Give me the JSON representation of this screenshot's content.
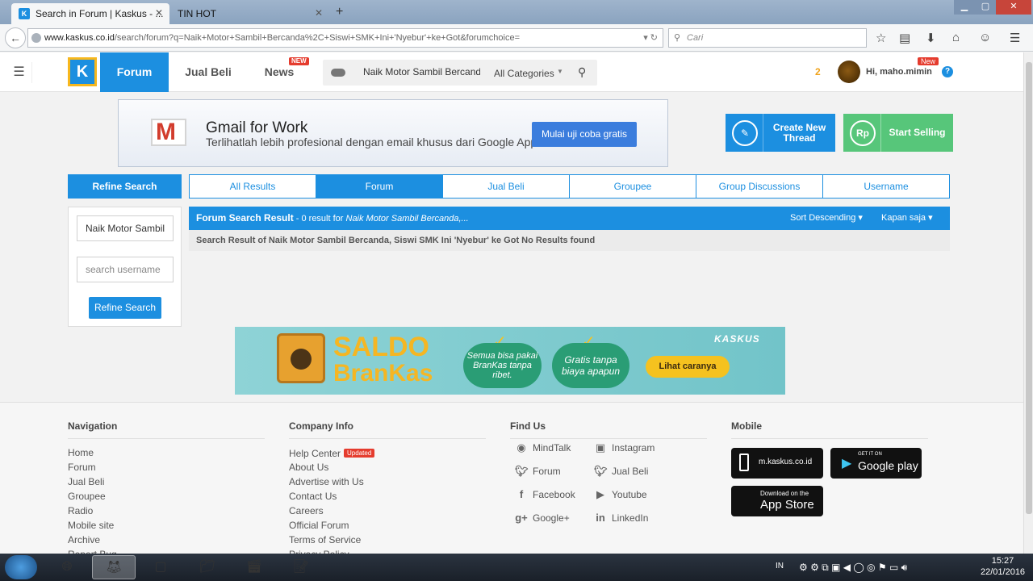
{
  "browser": {
    "tabs": [
      {
        "label": "Search in Forum | Kaskus - ...",
        "active": true
      },
      {
        "label": "TIN HOT",
        "active": false
      }
    ],
    "url_host": "www.kaskus.co.id",
    "url_path": "/search/forum?q=Naik+Motor+Sambil+Bercanda%2C+Siswi+SMK+Ini+'Nyebur'+ke+Got&forumchoice=",
    "search_placeholder": "Cari"
  },
  "header": {
    "logo": "K",
    "nav": [
      {
        "label": "Forum"
      },
      {
        "label": "Jual Beli"
      },
      {
        "label": "News",
        "badge": "NEW"
      }
    ],
    "search_query": "Naik Motor Sambil Bercanda",
    "category": "All Categories",
    "notifications": "2",
    "greeting": "Hi, maho.mimin",
    "new_badge": "New"
  },
  "ad": {
    "title": "Gmail for Work",
    "subtitle": "Terlihatlah lebih profesional dengan email khusus dari Google Apps.",
    "button": "Mulai uji coba gratis"
  },
  "actions": {
    "create_thread": "Create New Thread",
    "start_selling": "Start Selling",
    "rp": "Rp"
  },
  "refine": {
    "heading": "Refine Search",
    "query_value": "Naik Motor Sambil",
    "username_placeholder": "search username",
    "button": "Refine Search"
  },
  "tabs": [
    "All Results",
    "Forum",
    "Jual Beli",
    "Groupee",
    "Group Discussions",
    "Username"
  ],
  "results": {
    "title": "Forum Search Result",
    "count_text": " - 0 result for ",
    "query_italic": "Naik Motor Sambil Bercanda,...",
    "sort": "Sort Descending",
    "time": "Kapan saja",
    "message": "Search Result of Naik Motor Sambil Bercanda, Siswi SMK Ini 'Nyebur' ke Got No Results found"
  },
  "saldo_banner": {
    "title_1": "SALDO",
    "title_2": "BranKas",
    "point_1": "Semua bisa pakai BranKas tanpa ribet.",
    "point_2": "Gratis tanpa biaya apapun",
    "cta": "Lihat caranya",
    "brand": "KASKUS"
  },
  "footer": {
    "navigation": {
      "heading": "Navigation",
      "links": [
        "Home",
        "Forum",
        "Jual Beli",
        "Groupee",
        "Radio",
        "Mobile site",
        "Archive",
        "Report Bug"
      ]
    },
    "company": {
      "heading": "Company Info",
      "links": [
        "Help Center",
        "About Us",
        "Advertise with Us",
        "Contact Us",
        "Careers",
        "Official Forum",
        "Terms of Service",
        "Privacy Policy"
      ],
      "updated_badge": "Updated"
    },
    "find_us": {
      "heading": "Find Us",
      "left": [
        "MindTalk",
        "Forum",
        "Facebook",
        "Google+"
      ],
      "right": [
        "Instagram",
        "Jual Beli",
        "Youtube",
        "LinkedIn"
      ]
    },
    "mobile": {
      "heading": "Mobile",
      "site": "m.kaskus.co.id",
      "gp_small": "GET IT ON",
      "gp_big": "Google play",
      "as_small": "Download on the",
      "as_big": "App Store"
    }
  },
  "taskbar": {
    "lang": "IN",
    "time": "15:27",
    "date": "22/01/2016"
  }
}
